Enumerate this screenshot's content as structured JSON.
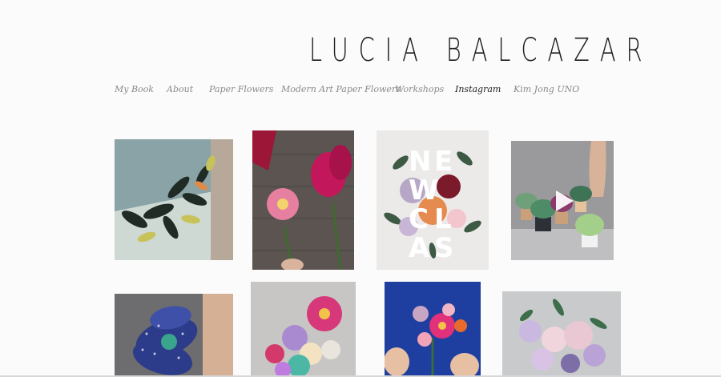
{
  "site": {
    "title": "LUCIA BALCAZAR"
  },
  "nav": {
    "items": [
      {
        "label": "My Book",
        "active": false
      },
      {
        "label": "About",
        "active": false
      },
      {
        "label": "Paper Flowers",
        "active": false
      },
      {
        "label": "Modern Art Paper Flowers",
        "active": false
      },
      {
        "label": "Workshops",
        "active": false
      },
      {
        "label": "Instagram",
        "active": true
      },
      {
        "label": "Kim Jong UNO",
        "active": false
      }
    ]
  },
  "gallery": {
    "overlay_text": "NEW CLASS",
    "video_icon": "play-icon",
    "palette": {
      "accent_pink": "#c2185b",
      "deep_blue": "#1e3ea0",
      "leaf_green": "#2f5d3a"
    }
  }
}
